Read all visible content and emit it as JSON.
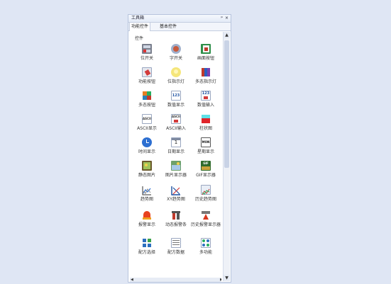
{
  "window": {
    "title": "工具箱",
    "pin_symbol": "ᵖ",
    "close_symbol": "×"
  },
  "tabs": [
    {
      "label": "功能控件"
    },
    {
      "label": "基本控件"
    }
  ],
  "group_label": "控件",
  "items": [
    {
      "label": "位开关",
      "icon": "bit-switch-icon"
    },
    {
      "label": "字开关",
      "icon": "word-switch-icon"
    },
    {
      "label": "画面按钮",
      "icon": "screen-button-icon"
    },
    {
      "label": "功能按钮",
      "icon": "function-button-icon"
    },
    {
      "label": "位指示灯",
      "icon": "bit-lamp-icon"
    },
    {
      "label": "多态指示灯",
      "icon": "multistate-lamp-icon"
    },
    {
      "label": "多态按钮",
      "icon": "multistate-button-icon"
    },
    {
      "label": "数值显示",
      "icon": "numeric-display-icon"
    },
    {
      "label": "数值输入",
      "icon": "numeric-input-icon"
    },
    {
      "label": "ASCII显示",
      "icon": "ascii-display-icon"
    },
    {
      "label": "ASCII输入",
      "icon": "ascii-input-icon"
    },
    {
      "label": "柱状图",
      "icon": "bar-graph-icon"
    },
    {
      "label": "时间显示",
      "icon": "clock-icon"
    },
    {
      "label": "日期显示",
      "icon": "calendar-icon"
    },
    {
      "label": "星期显示",
      "icon": "weekday-icon"
    },
    {
      "label": "静态图片",
      "icon": "static-image-icon"
    },
    {
      "label": "图片显示器",
      "icon": "image-viewer-icon"
    },
    {
      "label": "GIF显示器",
      "icon": "gif-viewer-icon"
    },
    {
      "label": "趋势图",
      "icon": "trend-chart-icon"
    },
    {
      "label": "XY趋势图",
      "icon": "xy-trend-icon"
    },
    {
      "label": "历史趋势图",
      "icon": "history-trend-icon"
    },
    {
      "label": "报警显示",
      "icon": "alarm-display-icon"
    },
    {
      "label": "动态报警条",
      "icon": "alarm-bar-icon"
    },
    {
      "label": "历史报警显示器",
      "icon": "history-alarm-icon"
    },
    {
      "label": "配方选择",
      "icon": "recipe-select-icon"
    },
    {
      "label": "配方数据",
      "icon": "recipe-data-icon"
    },
    {
      "label": "多功能",
      "icon": "multifunction-icon"
    }
  ],
  "icon_texts": {
    "numeric": "123",
    "ascii": "ASCII",
    "date": "1",
    "weekday": "MON",
    "gif": "GIF"
  },
  "scrollbar": {
    "up": "▲",
    "down": "▼",
    "left": "◀",
    "right": "▶"
  }
}
